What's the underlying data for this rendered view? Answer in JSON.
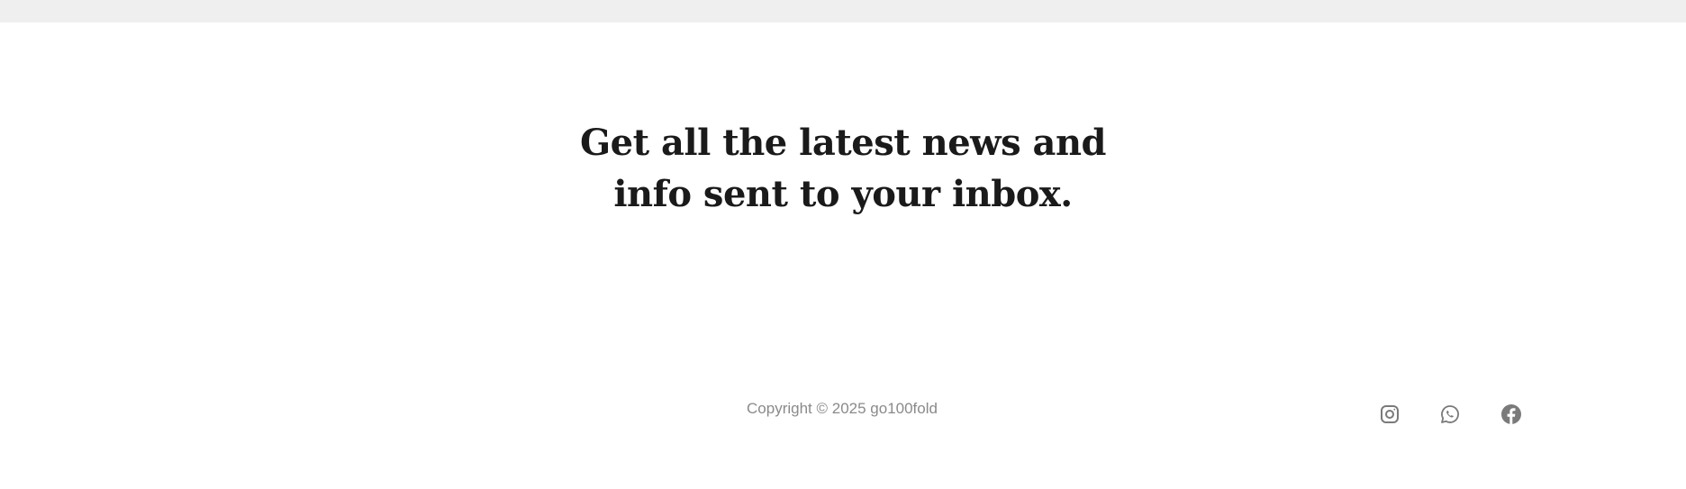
{
  "newsletter": {
    "headline": "Get all the latest news and info sent to your inbox."
  },
  "footer": {
    "copyright": "Copyright © 2025 go100fold",
    "social": [
      {
        "icon": "instagram-icon"
      },
      {
        "icon": "whatsapp-icon"
      },
      {
        "icon": "facebook-icon"
      }
    ],
    "icon_color": "#7a7a7a"
  },
  "colors": {
    "top_bar": "#efefef",
    "headline": "#1a1a1a",
    "copyright": "#8a8a8a"
  }
}
